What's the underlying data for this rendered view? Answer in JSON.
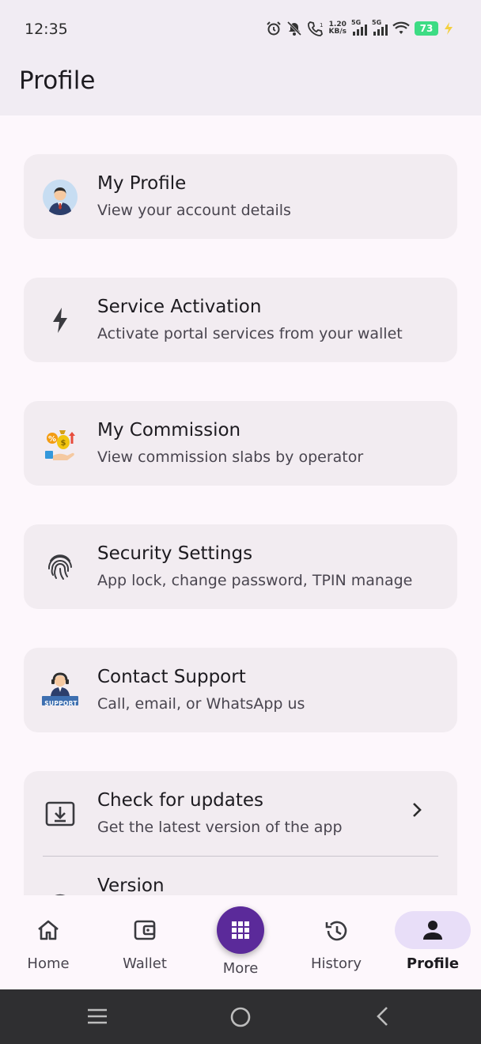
{
  "status_bar": {
    "time": "12:35",
    "net_speed_value": "1.20",
    "net_speed_unit": "KB/s",
    "sim1": "5G",
    "sim2": "5G",
    "battery": "73"
  },
  "header": {
    "title": "Profile"
  },
  "menu": [
    {
      "title": "My Profile",
      "subtitle": "View your account details",
      "icon": "user-avatar-icon"
    },
    {
      "title": "Service Activation",
      "subtitle": "Activate portal services from your wallet",
      "icon": "lightning-bolt-icon"
    },
    {
      "title": "My Commission",
      "subtitle": "View commission slabs by operator",
      "icon": "commission-icon"
    },
    {
      "title": "Security Settings",
      "subtitle": "App lock, change password, TPIN manage",
      "icon": "fingerprint-icon"
    },
    {
      "title": "Contact Support",
      "subtitle": "Call, email, or WhatsApp us",
      "icon": "support-agent-icon",
      "badge": "SUPPORT"
    }
  ],
  "app_card": {
    "update_title": "Check for updates",
    "update_subtitle": "Get the latest version of the app",
    "version_title": "Version"
  },
  "bottom_nav": {
    "home": "Home",
    "wallet": "Wallet",
    "more": "More",
    "history": "History",
    "profile": "Profile",
    "active": "profile"
  },
  "colors": {
    "accent": "#5b2a9a",
    "active_pill": "#e8def8",
    "card_bg": "#f2ecf1",
    "battery": "#3ddc84"
  }
}
